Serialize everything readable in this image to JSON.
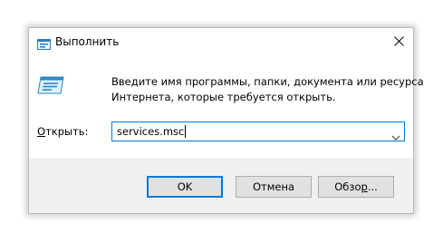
{
  "dialog": {
    "title": "Выполнить",
    "description_line1": "Введите имя программы, папки, документа или ресурса",
    "description_line2": "Интернета, которые требуется открыть.",
    "open_label_hotkey": "О",
    "open_label_rest": "ткрыть:",
    "command_value": "services.msc"
  },
  "buttons": {
    "ok_label": "OK",
    "cancel_label": "Отмена",
    "browse_label_pre": "Обзо",
    "browse_label_hotkey": "р",
    "browse_label_post": "..."
  },
  "icons": {
    "title": "run-icon",
    "main": "run-icon",
    "close": "close-icon",
    "dropdown": "chevron-down-icon"
  },
  "colors": {
    "accent": "#0078d7",
    "footer_bg": "#f0f0f0",
    "button_bg": "#e1e1e1"
  }
}
